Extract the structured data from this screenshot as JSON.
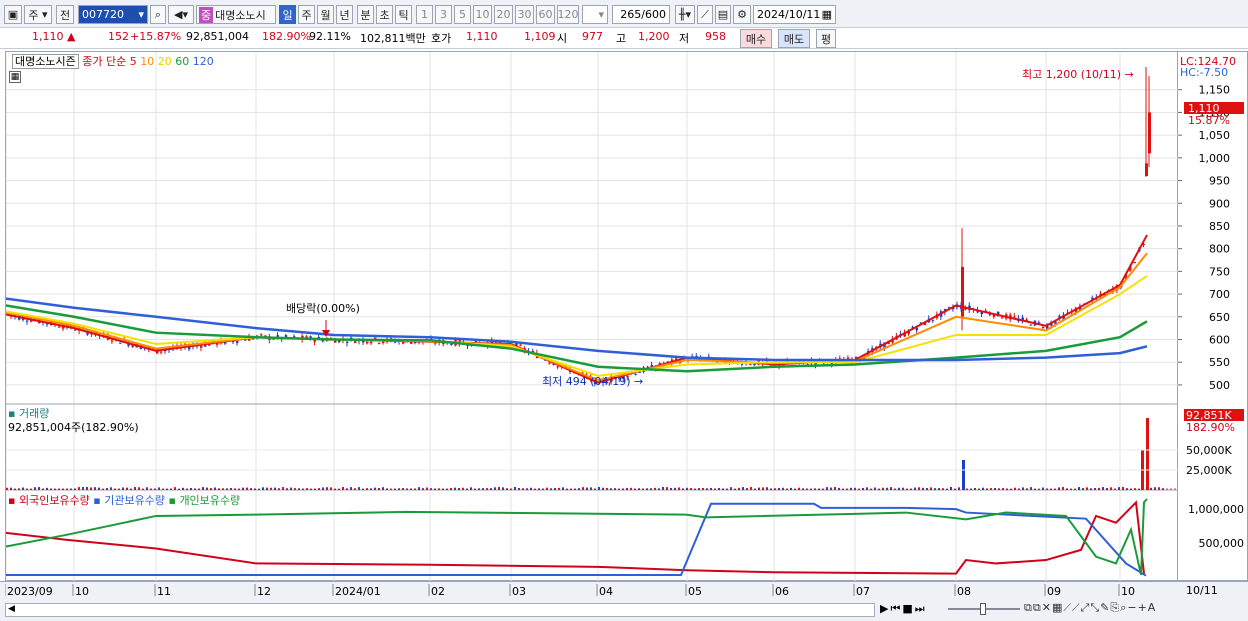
{
  "toolbar": {
    "market_label": "주",
    "prev_label": "전",
    "code_value": "007720",
    "stock_name": "대명소노시",
    "period_buttons": [
      "일",
      "주",
      "월",
      "년",
      "분",
      "초",
      "틱"
    ],
    "minute_buttons": [
      "1",
      "3",
      "5",
      "10",
      "20",
      "30",
      "60",
      "120"
    ],
    "count_value": "265",
    "count_max": "/600",
    "date_value": "2024/10/11"
  },
  "quote": {
    "price": "1,110",
    "change": "152",
    "change_pct": "+15.87%",
    "volume": "92,851,004",
    "volume_ratio": "182.90%",
    "rotation": "92.11%",
    "amount": "102,811백만",
    "hoga_label": "호가",
    "ask": "1,110",
    "bid": "1,109",
    "open_label": "시",
    "open": "977",
    "high_label": "고",
    "high": "1,200",
    "low_label": "저",
    "low": "958",
    "buy_label": "매수",
    "sell_label": "매도",
    "eval_label": "평"
  },
  "price_pane": {
    "legend_name": "대명소노시즌",
    "legend_ma": "종가 단순",
    "ma_periods": [
      "5",
      "10",
      "20",
      "60",
      "120"
    ],
    "ma_colors": [
      "#e01010",
      "#ff8c00",
      "#f5e100",
      "#1a9b3a",
      "#2f5fd8"
    ],
    "lc": "LC:124.70",
    "hc": "HC:-7.50",
    "high_annotation": "최고 1,200 (10/11)",
    "low_annotation": "최저 494 (04/19)",
    "dividend_annotation": "배당락(0.00%)",
    "current_price_tag": "1,110",
    "current_pct_tag": "15.87%",
    "y_ticks": [
      "1,150",
      "1,100",
      "1,050",
      "1,000",
      "950",
      "900",
      "850",
      "800",
      "750",
      "700",
      "650",
      "600",
      "550",
      "500"
    ]
  },
  "volume_pane": {
    "title": "거래량",
    "value": "92,851,004주(182.90%)",
    "tag_value": "92,851K",
    "tag_pct": "182.90%",
    "y_ticks": [
      "50,000K",
      "25,000K"
    ]
  },
  "holding_pane": {
    "legend": [
      {
        "label": "외국인보유수량",
        "color": "#d0021b"
      },
      {
        "label": "기관보유수량",
        "color": "#2f5fd8"
      },
      {
        "label": "개인보유수량",
        "color": "#1a9b3a"
      }
    ],
    "y_ticks": [
      "1,000,000",
      "500,000"
    ]
  },
  "x_axis": {
    "labels": [
      "2023/09",
      "10",
      "11",
      "12",
      "2024/01",
      "02",
      "03",
      "04",
      "05",
      "06",
      "07",
      "08",
      "09",
      "10"
    ],
    "right_label": "10/11"
  },
  "chart_data": {
    "type": "line",
    "title": "대명소노시즌",
    "x": [
      "2023/09",
      "10",
      "11",
      "12",
      "2024/01",
      "02",
      "03",
      "04",
      "05",
      "06",
      "07",
      "08",
      "09",
      "10",
      "10/11"
    ],
    "series": [
      {
        "name": "5",
        "values": [
          655,
          625,
          575,
          605,
          600,
          595,
          590,
          505,
          560,
          545,
          555,
          675,
          630,
          720,
          830
        ]
      },
      {
        "name": "10",
        "values": [
          660,
          630,
          580,
          605,
          600,
          596,
          588,
          510,
          555,
          548,
          552,
          650,
          620,
          715,
          790
        ]
      },
      {
        "name": "20",
        "values": [
          662,
          635,
          590,
          605,
          600,
          597,
          585,
          520,
          545,
          550,
          550,
          610,
          610,
          700,
          740
        ]
      },
      {
        "name": "60",
        "values": [
          675,
          650,
          615,
          605,
          600,
          598,
          580,
          540,
          530,
          540,
          545,
          560,
          575,
          605,
          640
        ]
      },
      {
        "name": "120",
        "values": [
          690,
          670,
          650,
          625,
          610,
          605,
          595,
          575,
          560,
          555,
          555,
          555,
          560,
          570,
          585
        ]
      }
    ],
    "ylim": [
      480,
      1200
    ]
  }
}
